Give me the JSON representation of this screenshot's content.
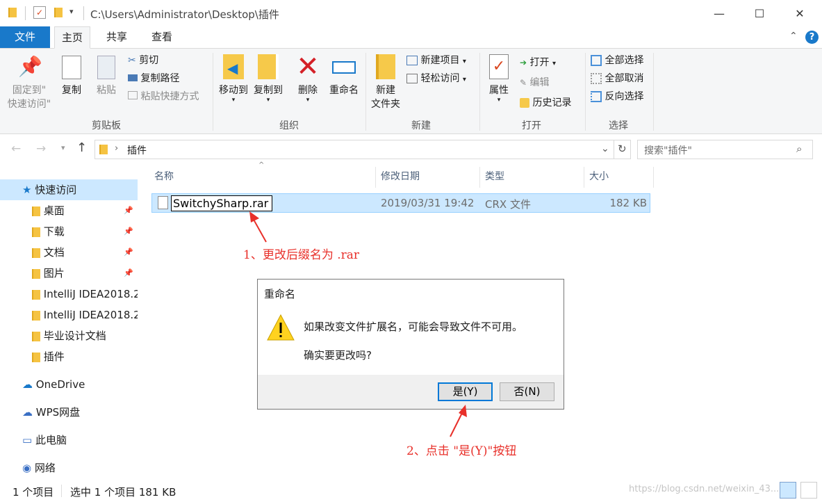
{
  "window": {
    "path": "C:\\Users\\Administrator\\Desktop\\插件",
    "minimize": "—",
    "maximize": "☐",
    "close": "✕"
  },
  "ribbon_tabs": [
    "文件",
    "主页",
    "共享",
    "查看"
  ],
  "clipboard": {
    "pin_line1": "固定到\"",
    "pin_line2": "快速访问\"",
    "copy": "复制",
    "paste": "粘贴",
    "cut": "剪切",
    "copy_path": "复制路径",
    "paste_shortcut": "粘贴快捷方式",
    "label": "剪贴板"
  },
  "organize": {
    "move_to": "移动到",
    "copy_to": "复制到",
    "delete": "删除",
    "rename": "重命名",
    "label": "组织"
  },
  "new_group": {
    "new_folder_line1": "新建",
    "new_folder_line2": "文件夹",
    "new_item": "新建项目",
    "easy_access": "轻松访问",
    "label": "新建"
  },
  "open_group": {
    "properties": "属性",
    "open": "打开",
    "edit": "编辑",
    "history": "历史记录",
    "label": "打开"
  },
  "select_group": {
    "select_all": "全部选择",
    "select_none": "全部取消",
    "invert": "反向选择",
    "label": "选择"
  },
  "address": {
    "crumb": "插件",
    "search_placeholder": "搜索\"插件\""
  },
  "nav": {
    "quick_access": "快速访问",
    "items": [
      "桌面",
      "下载",
      "文档",
      "图片",
      "IntelliJ IDEA2018.2",
      "IntelliJ IDEA2018.2",
      "毕业设计文档",
      "插件"
    ],
    "onedrive": "OneDrive",
    "wps": "WPS网盘",
    "this_pc": "此电脑",
    "network": "网络"
  },
  "columns": {
    "name": "名称",
    "modified": "修改日期",
    "type": "类型",
    "size": "大小"
  },
  "file": {
    "name": "SwitchySharp.rar",
    "modified": "2019/03/31 19:42",
    "type": "CRX 文件",
    "size": "182 KB"
  },
  "dialog": {
    "title": "重命名",
    "message": "如果改变文件扩展名，可能会导致文件不可用。",
    "question": "确实要更改吗?",
    "yes": "是(Y)",
    "no": "否(N)"
  },
  "annotations": {
    "step1": "1、更改后缀名为 .rar",
    "step2": "2、点击 \"是(Y)\"按钮",
    "color": "#e8302a"
  },
  "status": {
    "count": "1 个项目",
    "selected": "选中 1 个项目  181 KB"
  },
  "watermark": "https://blog.csdn.net/weixin_43..."
}
